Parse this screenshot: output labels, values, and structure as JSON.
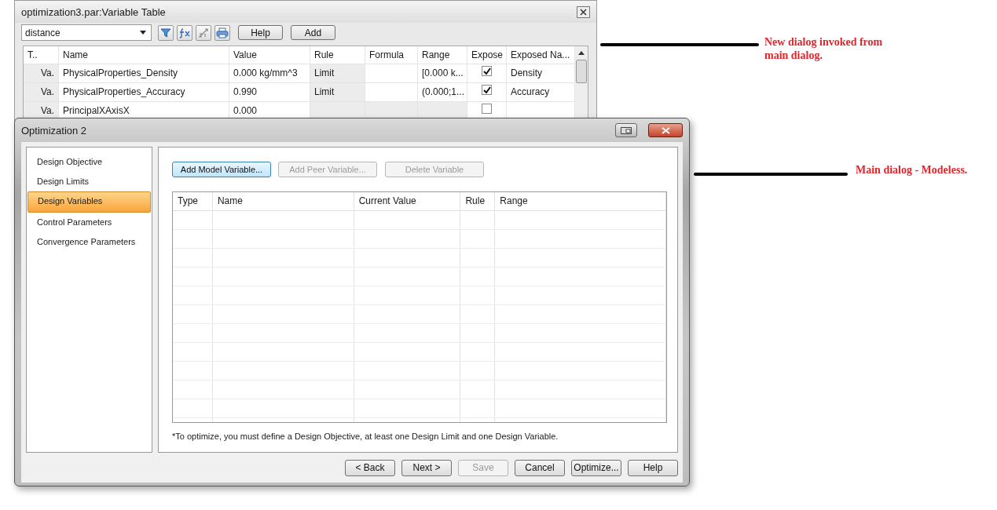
{
  "variable_table": {
    "title": "optimization3.par:Variable Table",
    "filter": "distance",
    "buttons": [
      "Help",
      "Add"
    ],
    "columns": [
      "T..",
      "Name",
      "Value",
      "Rule",
      "Formula",
      "Range",
      "Expose",
      "Exposed Na..."
    ],
    "rows": [
      {
        "type": "Va.",
        "name": "PhysicalProperties_Density",
        "value": "0.000 kg/mm^3",
        "rule": "Limit",
        "formula": "",
        "range": "[0.000 k...",
        "expose": true,
        "exposed_name": "Density"
      },
      {
        "type": "Va.",
        "name": "PhysicalProperties_Accuracy",
        "value": "0.990",
        "rule": "Limit",
        "formula": "",
        "range": "(0.000;1...",
        "expose": true,
        "exposed_name": "Accuracy"
      },
      {
        "type": "Va.",
        "name": "PrincipalXAxisX",
        "value": "0.000",
        "rule": "",
        "formula": "",
        "range": "",
        "expose": false,
        "exposed_name": ""
      }
    ]
  },
  "main_dialog": {
    "title": "Optimization 2",
    "nav": [
      {
        "label": "Design Objective",
        "selected": false
      },
      {
        "label": "Design Limits",
        "selected": false
      },
      {
        "label": "Design Variables",
        "selected": true
      },
      {
        "label": "Control Parameters",
        "selected": false
      },
      {
        "label": "Convergence Parameters",
        "selected": false
      }
    ],
    "actions": [
      {
        "label": "Add Model Variable...",
        "disabled": false
      },
      {
        "label": "Add Peer Variable...",
        "disabled": true
      },
      {
        "label": "Delete Variable",
        "disabled": true
      }
    ],
    "columns": [
      "Type",
      "Name",
      "Current Value",
      "Rule",
      "Range"
    ],
    "note": "*To optimize, you must define a Design Objective, at least one Design Limit and one Design Variable.",
    "footer": [
      {
        "label": "< Back",
        "disabled": false
      },
      {
        "label": "Next >",
        "disabled": false
      },
      {
        "label": "Save",
        "disabled": true
      },
      {
        "label": "Cancel",
        "disabled": false
      },
      {
        "label": "Optimize...",
        "disabled": false
      },
      {
        "label": "Help",
        "disabled": false
      }
    ]
  },
  "annotations": [
    "New dialog invoked from main dialog.",
    "Main dialog - Modeless."
  ]
}
